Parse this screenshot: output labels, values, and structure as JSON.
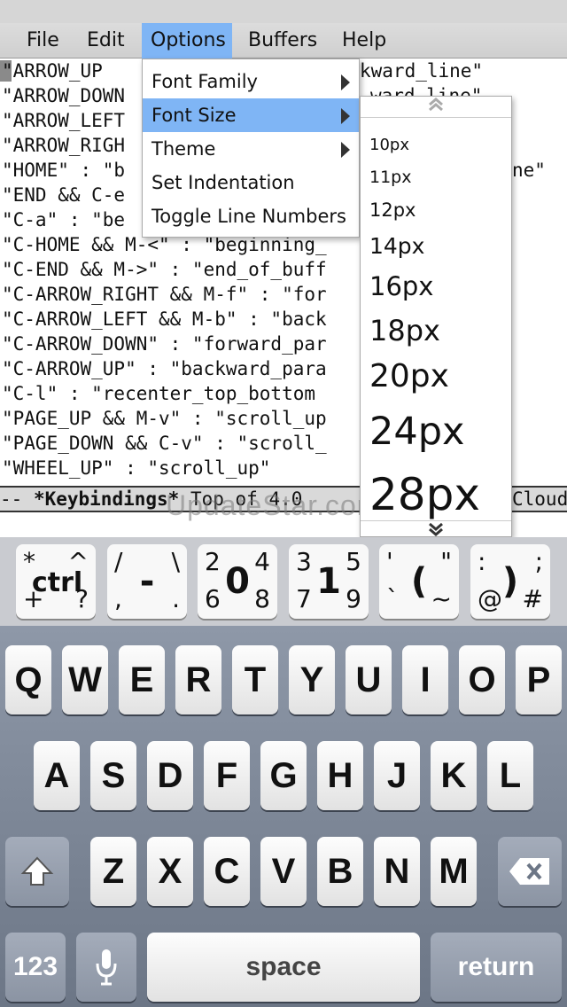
{
  "menubar": {
    "items": [
      "File",
      "Edit",
      "Options",
      "Buffers",
      "Help"
    ],
    "active": "Options"
  },
  "editor": {
    "lines": [
      "\"ARROW_UP",
      "\"ARROW_DOWN",
      "\"ARROW_LEFT",
      "\"ARROW_RIGH",
      "\"HOME\" : \"b",
      "\"END && C-e",
      "\"C-a\" : \"be",
      "\"C-HOME && M-<\" : \"beginning_",
      "\"C-END && M->\" : \"end_of_buff",
      "\"C-ARROW_RIGHT && M-f\" : \"for",
      "\"C-ARROW_LEFT && M-b\" : \"back",
      "\"C-ARROW_DOWN\" : \"forward_par",
      "\"C-ARROW_UP\" : \"backward_para",
      "\"C-l\" : \"recenter_top_bottom",
      "\"PAGE_UP && M-v\" : \"scroll_up",
      "\"PAGE_DOWN && C-v\" : \"scroll_",
      "\"WHEEL_UP\" : \"scroll_up\""
    ],
    "right_fragments": [
      {
        "text": "kward_line\"",
        "line": 0
      },
      {
        "text": "ward_line\"",
        "line": 1
      },
      {
        "text": "ne\"",
        "line": 4
      }
    ]
  },
  "modeline": {
    "prefix": "-- ",
    "buffer": "*Keybindings*",
    "middle": " Top of 4.0",
    "right": "Cloud"
  },
  "watermark": "UpdateStar.com",
  "options_menu": {
    "items": [
      {
        "label": "Font Family",
        "submenu": true
      },
      {
        "label": "Font Size",
        "submenu": true
      },
      {
        "label": "Theme",
        "submenu": true
      },
      {
        "label": "Set Indentation",
        "submenu": false
      },
      {
        "label": "Toggle Line Numbers",
        "submenu": false
      }
    ],
    "active": "Font Size"
  },
  "font_size_menu": {
    "items": [
      "10px",
      "11px",
      "12px",
      "14px",
      "16px",
      "18px",
      "20px",
      "24px",
      "28px"
    ],
    "scroll_up_icon": "double-chevron-up",
    "scroll_down_icon": "double-chevron-down"
  },
  "extra_keys": [
    {
      "name": "ctrl",
      "center": "ctrl",
      "tl": "*",
      "tr": "^",
      "bl": "+",
      "br": "?"
    },
    {
      "name": "dash",
      "center": "-",
      "tl": "/",
      "tr": "\\",
      "bl": ",",
      "br": "."
    },
    {
      "name": "zero",
      "center": "0",
      "tl": "2",
      "tr": "4",
      "bl": "6",
      "br": "8"
    },
    {
      "name": "one",
      "center": "1",
      "tl": "3",
      "tr": "5",
      "bl": "7",
      "br": "9"
    },
    {
      "name": "paren-open",
      "center": "(",
      "tl": "'",
      "tr": "\"",
      "bl": "`",
      "br": "~"
    },
    {
      "name": "paren-close",
      "center": ")",
      "tl": ":",
      "tr": ";",
      "bl": "@",
      "br": "#"
    }
  ],
  "keyboard": {
    "row1": [
      "Q",
      "W",
      "E",
      "R",
      "T",
      "Y",
      "U",
      "I",
      "O",
      "P"
    ],
    "row2": [
      "A",
      "S",
      "D",
      "F",
      "G",
      "H",
      "J",
      "K",
      "L"
    ],
    "row3": [
      "Z",
      "X",
      "C",
      "V",
      "B",
      "N",
      "M"
    ],
    "numbers_key": "123",
    "space_key": "space",
    "return_key": "return",
    "shift_icon": "shift-icon",
    "delete_icon": "backspace-icon",
    "mic_icon": "microphone-icon"
  }
}
